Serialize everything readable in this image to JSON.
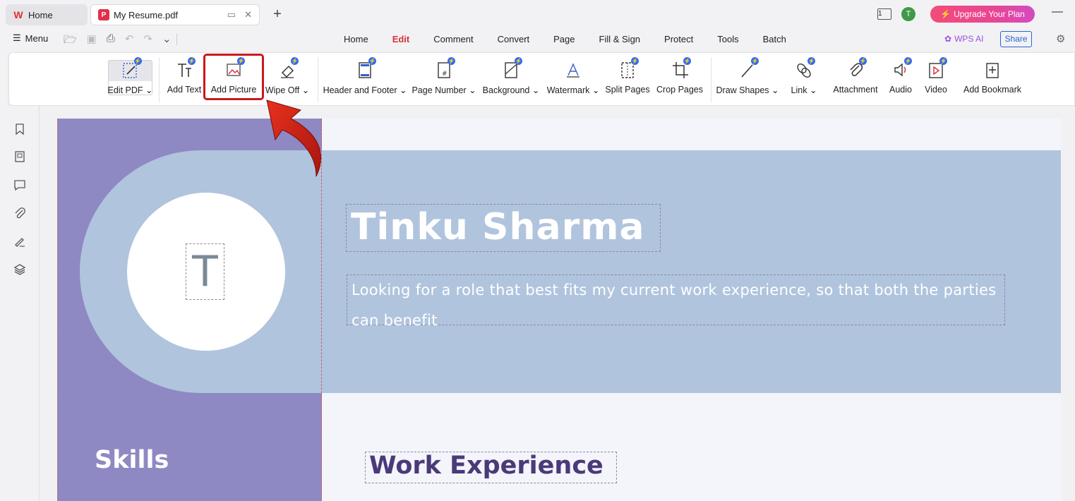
{
  "titlebar": {
    "home_tab": "Home",
    "doc_tab": "My Resume.pdf",
    "new_tab_icon": "+",
    "page_count": "1",
    "avatar_letter": "T",
    "upgrade_label": "Upgrade Your Plan"
  },
  "menubar": {
    "menu_label": "Menu",
    "tabs": [
      "Home",
      "Edit",
      "Comment",
      "Convert",
      "Page",
      "Fill & Sign",
      "Protect",
      "Tools",
      "Batch"
    ],
    "active_tab": "Edit",
    "wps_ai": "WPS AI",
    "share": "Share"
  },
  "ribbon": {
    "edit_pdf": "Edit PDF",
    "add_text": "Add Text",
    "add_picture": "Add Picture",
    "wipe_off": "Wipe Off",
    "header_footer": "Header and Footer",
    "page_number": "Page Number",
    "background": "Background",
    "watermark": "Watermark",
    "split_pages": "Split Pages",
    "crop_pages": "Crop Pages",
    "draw_shapes": "Draw Shapes",
    "link": "Link",
    "attachment": "Attachment",
    "audio": "Audio",
    "video": "Video",
    "add_bookmark": "Add Bookmark"
  },
  "document": {
    "monogram": "T",
    "name": "Tinku Sharma",
    "objective": "Looking for a role that best fits my current work experience, so that both the parties can benefit",
    "skills_heading": "Skills",
    "work_heading": "Work Experience"
  },
  "colors": {
    "accent_red": "#d4303a",
    "left_column": "#8e89c2",
    "header_band": "#b0c4dd",
    "upgrade_pink": "#e94593",
    "highlight_red": "#c8191f"
  }
}
